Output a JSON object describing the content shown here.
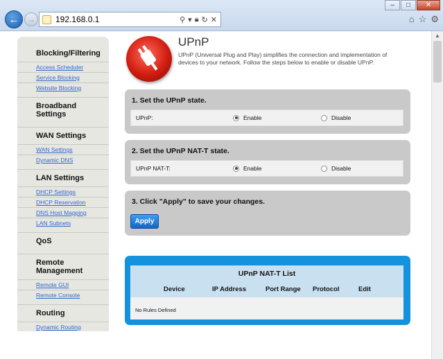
{
  "browser": {
    "url": "192.168.0.1",
    "window_controls": [
      "minimize",
      "maximize",
      "close"
    ],
    "toolbar_icons": [
      "home-icon",
      "star-icon",
      "gear-icon"
    ],
    "address_tools": [
      "search-icon",
      "lock-icon",
      "refresh-icon",
      "stop-icon"
    ]
  },
  "sidebar": {
    "groups": [
      {
        "heading": "Blocking/Filtering",
        "links": [
          "Access Scheduler",
          "Service Blocking",
          "Website Blocking"
        ]
      },
      {
        "heading": "Broadband Settings",
        "links": []
      },
      {
        "heading": "WAN Settings",
        "links": [
          "WAN Settings",
          "Dynamic DNS"
        ]
      },
      {
        "heading": "LAN Settings",
        "links": [
          "DHCP Settings",
          "DHCP Reservation",
          "DNS Host Mapping",
          "LAN Subnets"
        ]
      },
      {
        "heading": "QoS",
        "links": []
      },
      {
        "heading": "Remote Management",
        "links": [
          "Remote GUI",
          "Remote Console"
        ]
      },
      {
        "heading": "Routing",
        "links": [
          "Dynamic Routing"
        ]
      }
    ]
  },
  "page": {
    "title": "UPnP",
    "description": "UPnP (Universal Plug and Play) simplifies the connection and implementation of devices to your network. Follow the steps below to enable or disable UPnP."
  },
  "step1": {
    "title": "1. Set the UPnP state.",
    "label": "UPnP:",
    "enable": "Enable",
    "disable": "Disable",
    "selected": "Enable"
  },
  "step2": {
    "title": "2. Set the UPnP NAT-T state.",
    "label": "UPnP NAT-T:",
    "enable": "Enable",
    "disable": "Disable",
    "selected": "Enable"
  },
  "step3": {
    "title": "3. Click \"Apply\" to save your changes.",
    "apply_label": "Apply"
  },
  "nat_list": {
    "title": "UPnP NAT-T List",
    "columns": [
      "Device",
      "IP Address",
      "Port Range",
      "Protocol",
      "Edit"
    ],
    "empty_text": "No Rules Defined"
  },
  "colors": {
    "accent_blue": "#1592dc",
    "panel_gray": "#c9c9c9",
    "sidebar_bg": "#e6e7e1",
    "link_blue": "#3366cc",
    "logo_red": "#d11d10"
  }
}
